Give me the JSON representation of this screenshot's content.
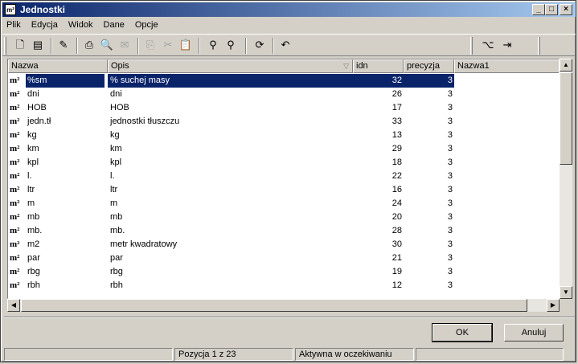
{
  "window": {
    "title": "Jednostki",
    "app_icon": "m²"
  },
  "menu": [
    "Plik",
    "Edycja",
    "Widok",
    "Dane",
    "Opcje"
  ],
  "columns": {
    "nazwa": "Nazwa",
    "opis": "Opis",
    "idn": "idn",
    "precyzja": "precyzja",
    "nazwa1": "Nazwa1"
  },
  "row_icon": "m²",
  "rows": [
    {
      "nazwa": "%sm",
      "opis": "% suchej masy",
      "idn": "32",
      "precyzja": "3"
    },
    {
      "nazwa": "dni",
      "opis": "dni",
      "idn": "26",
      "precyzja": "3"
    },
    {
      "nazwa": "HOB",
      "opis": "HOB",
      "idn": "17",
      "precyzja": "3"
    },
    {
      "nazwa": "jedn.tł",
      "opis": "jednostki tłuszczu",
      "idn": "33",
      "precyzja": "3"
    },
    {
      "nazwa": "kg",
      "opis": "kg",
      "idn": "13",
      "precyzja": "3"
    },
    {
      "nazwa": "km",
      "opis": "km",
      "idn": "29",
      "precyzja": "3"
    },
    {
      "nazwa": "kpl",
      "opis": "kpl",
      "idn": "18",
      "precyzja": "3"
    },
    {
      "nazwa": "l.",
      "opis": "l.",
      "idn": "22",
      "precyzja": "3"
    },
    {
      "nazwa": "ltr",
      "opis": "ltr",
      "idn": "16",
      "precyzja": "3"
    },
    {
      "nazwa": "m",
      "opis": "m",
      "idn": "24",
      "precyzja": "3"
    },
    {
      "nazwa": "mb",
      "opis": "mb",
      "idn": "20",
      "precyzja": "3"
    },
    {
      "nazwa": "mb.",
      "opis": "mb.",
      "idn": "28",
      "precyzja": "3"
    },
    {
      "nazwa": "m2",
      "opis": "metr kwadratowy",
      "idn": "30",
      "precyzja": "3"
    },
    {
      "nazwa": "par",
      "opis": "par",
      "idn": "21",
      "precyzja": "3"
    },
    {
      "nazwa": "rbg",
      "opis": "rbg",
      "idn": "19",
      "precyzja": "3"
    },
    {
      "nazwa": "rbh",
      "opis": "rbh",
      "idn": "12",
      "precyzja": "3"
    }
  ],
  "buttons": {
    "ok": "OK",
    "cancel": "Anuluj"
  },
  "status": {
    "position": "Pozycja 1 z 23",
    "state": "Aktywna w oczekiwaniu"
  },
  "colors": {
    "selection": "#0a246a",
    "titlebar": "#0a246a",
    "face": "#d4d0c8"
  }
}
